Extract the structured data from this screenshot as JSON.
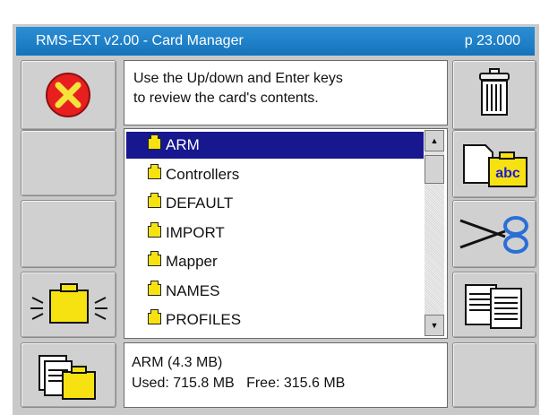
{
  "window": {
    "title": "RMS-EXT v2.00 - Card Manager",
    "page": "p 23.000"
  },
  "info": {
    "line1": "Use the Up/down and Enter keys",
    "line2": "to review the card's contents."
  },
  "list": {
    "items": [
      {
        "label": "ARM",
        "selected": true
      },
      {
        "label": "Controllers",
        "selected": false
      },
      {
        "label": "DEFAULT",
        "selected": false
      },
      {
        "label": "IMPORT",
        "selected": false
      },
      {
        "label": "Mapper",
        "selected": false
      },
      {
        "label": "NAMES",
        "selected": false
      },
      {
        "label": "PROFILES",
        "selected": false
      }
    ]
  },
  "status": {
    "selection": "ARM (4.3 MB)",
    "usage": "Used: 715.8 MB   Free: 315.6 MB"
  },
  "buttons": {
    "left": [
      "cancel-x-icon",
      "blank",
      "blank",
      "open-folder-icon",
      "copy-folder-icon"
    ],
    "right": [
      "trash-icon",
      "rename-abc-icon",
      "scissors-icon",
      "copy-docs-icon",
      "blank"
    ]
  },
  "colors": {
    "title_bar": "#1e7fc8",
    "selection": "#17178f",
    "folder": "#f7e211",
    "cancel": "#e81f1f"
  }
}
